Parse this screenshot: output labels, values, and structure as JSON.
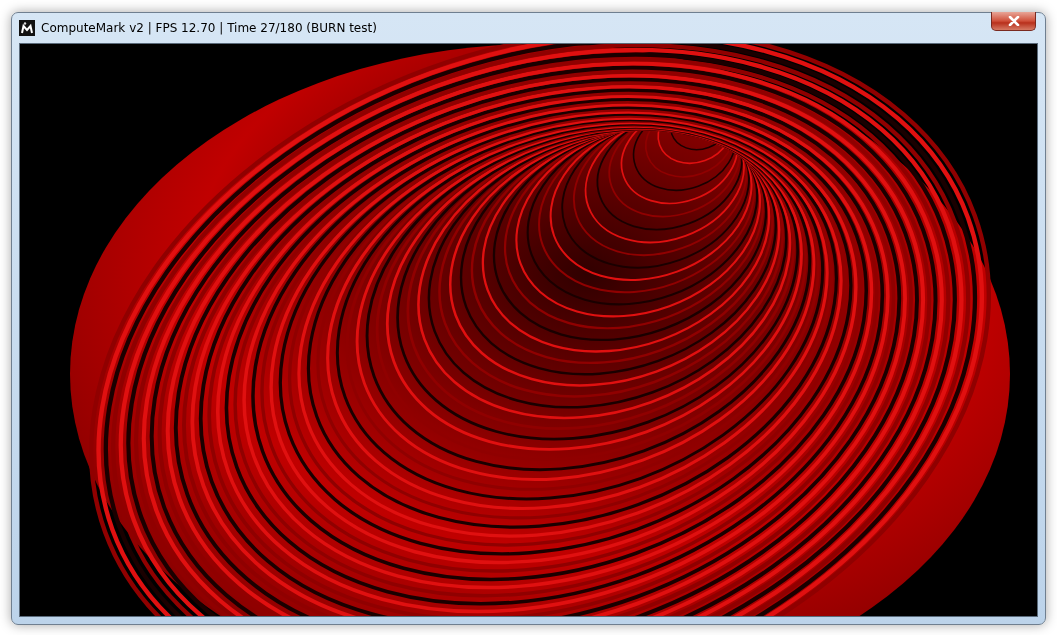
{
  "window": {
    "title": "ComputeMark v2 | FPS 12.70 | Time 27/180 (BURN test)"
  }
}
